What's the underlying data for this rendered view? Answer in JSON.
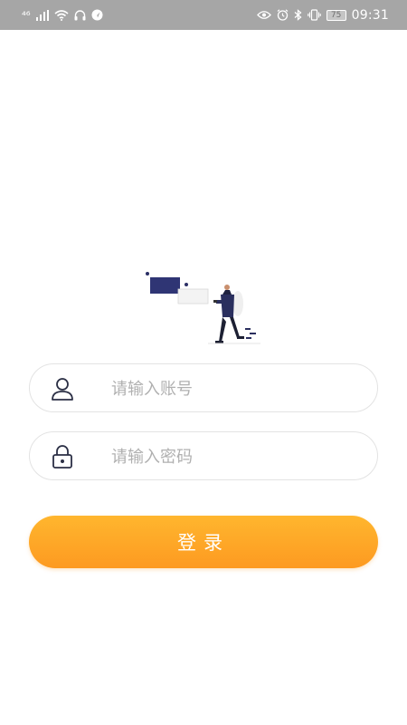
{
  "status_bar": {
    "signal_text": "⁴⁶",
    "battery": "75",
    "time": "09:31"
  },
  "login": {
    "username_placeholder": "请输入账号",
    "password_placeholder": "请输入密码",
    "submit_label": "登录"
  },
  "colors": {
    "accent_top": "#ffb62e",
    "accent_bottom": "#fd9a21",
    "icon_color": "#2b2f45"
  }
}
